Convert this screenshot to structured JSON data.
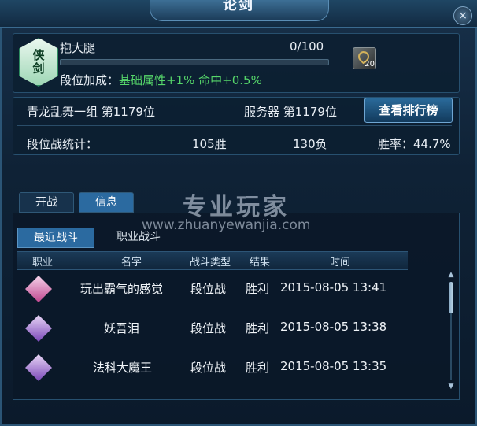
{
  "window": {
    "title": "论剑",
    "close_label": "×"
  },
  "badge": {
    "line1": "侠",
    "line2": "剑"
  },
  "rank": {
    "name": "抱大腿",
    "progress_text": "0/100",
    "progress_fraction": 0.0,
    "bonus_label": "段位加成：",
    "bonus_value": "基础属性+1% 命中+0.5%"
  },
  "item": {
    "icon": "key-icon",
    "count": "20"
  },
  "group": {
    "group_rank": "青龙乱舞一组 第1179位",
    "server_rank": "服务器 第1179位",
    "leaderboard_button": "查看排行榜"
  },
  "stats": {
    "label": "段位战统计：",
    "wins": "105胜",
    "losses": "130负",
    "winrate": "胜率：44.7%"
  },
  "tabs": {
    "open": "开战",
    "info": "信息"
  },
  "subtabs": {
    "recent": "最近战斗",
    "job": "职业战斗"
  },
  "columns": [
    "职业",
    "名字",
    "战斗类型",
    "结果",
    "时间"
  ],
  "battles": [
    {
      "job_icon": "pink-fan-icon",
      "name": "玩出霸气的感觉",
      "type": "段位战",
      "result": "胜利",
      "time": "2015-08-05 13:41"
    },
    {
      "job_icon": "purple-fan-icon",
      "name": "妖吾泪",
      "type": "段位战",
      "result": "胜利",
      "time": "2015-08-05 13:38"
    },
    {
      "job_icon": "purple-fan-icon",
      "name": "法科大魔王",
      "type": "段位战",
      "result": "胜利",
      "time": "2015-08-05 13:35"
    }
  ],
  "watermark": {
    "big": "专业玩家",
    "small": "www.zhuanyewanjia.com"
  }
}
